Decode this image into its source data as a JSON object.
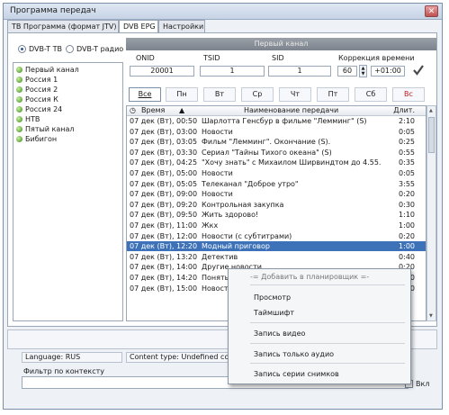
{
  "window": {
    "title": "Программа передач",
    "close_label": "✕"
  },
  "tabs": [
    {
      "label": "ТВ Программа (формат JTV)"
    },
    {
      "label": "DVB EPG"
    },
    {
      "label": "Настройки"
    }
  ],
  "source": {
    "dvbt_tv": "DVB-T ТВ",
    "dvbt_radio": "DVB-T радио",
    "selected": "DVB-T ТВ"
  },
  "channels": [
    {
      "name": "Первый канал"
    },
    {
      "name": "Россия 1"
    },
    {
      "name": "Россия 2"
    },
    {
      "name": "Россия К"
    },
    {
      "name": "Россия 24"
    },
    {
      "name": "НТВ"
    },
    {
      "name": "Пятый канал"
    },
    {
      "name": "Бибигон"
    }
  ],
  "channel_header": "Первый канал",
  "ids": {
    "onid_label": "ONID",
    "onid": "20001",
    "tsid_label": "TSID",
    "tsid": "1",
    "sid_label": "SID",
    "sid": "1",
    "correction_label": "Коррекция времени",
    "correction_minutes": "60",
    "correction_offset": "+01:00",
    "apply_icon": "checkmark-icon"
  },
  "days": [
    {
      "label": "Все"
    },
    {
      "label": "Пн"
    },
    {
      "label": "Вт"
    },
    {
      "label": "Ср"
    },
    {
      "label": "Чт"
    },
    {
      "label": "Пт"
    },
    {
      "label": "Сб"
    },
    {
      "label": "Вс"
    }
  ],
  "selected_day": "Все",
  "sunday_color": "#c02020",
  "grid": {
    "col_time": "Время",
    "col_name": "Наименование передачи",
    "col_duration": "Длит.",
    "rows": [
      {
        "time": "07 дек (Вт), 00:50",
        "name": "Шарлотта Генсбур в фильме \"Лемминг\" (S)",
        "dur": "2:10"
      },
      {
        "time": "07 дек (Вт), 03:00",
        "name": "Новости",
        "dur": "0:05"
      },
      {
        "time": "07 дек (Вт), 03:05",
        "name": "Фильм \"Лемминг\". Окончание (S).",
        "dur": "0:25"
      },
      {
        "time": "07 дек (Вт), 03:30",
        "name": "Сериал \"Тайны Тихого океана\" (S)",
        "dur": "0:55"
      },
      {
        "time": "07 дек (Вт), 04:25",
        "name": "\"Хочу знать\" с Михаилом Ширвиндтом до 4.55.",
        "dur": "0:35"
      },
      {
        "time": "07 дек (Вт), 05:00",
        "name": "Новости",
        "dur": "0:05"
      },
      {
        "time": "07 дек (Вт), 05:05",
        "name": "Телеканал \"Доброе утро\"",
        "dur": "3:55"
      },
      {
        "time": "07 дек (Вт), 09:00",
        "name": "Новости",
        "dur": "0:20"
      },
      {
        "time": "07 дек (Вт), 09:20",
        "name": "Контрольная закупка",
        "dur": "0:30"
      },
      {
        "time": "07 дек (Вт), 09:50",
        "name": "Жить здорово!",
        "dur": "1:10"
      },
      {
        "time": "07 дек (Вт), 11:00",
        "name": "Жкх",
        "dur": "1:00"
      },
      {
        "time": "07 дек (Вт), 12:00",
        "name": "Новости (с субтитрами)",
        "dur": "0:20"
      },
      {
        "time": "07 дек (Вт), 12:20",
        "name": "Модный приговор",
        "dur": "1:00"
      },
      {
        "time": "07 дек (Вт), 13:20",
        "name": "Детектив",
        "dur": "0:40"
      },
      {
        "time": "07 дек (Вт), 14:00",
        "name": "Другие новости",
        "dur": "0:20"
      },
      {
        "time": "07 дек (Вт), 14:20",
        "name": "Понять. Простить",
        "dur": "0:40"
      },
      {
        "time": "07 дек (Вт), 15:00",
        "name": "Новости",
        "dur": "0:20"
      }
    ],
    "selected_index": 12
  },
  "status": {
    "language": "Language: RUS",
    "content_type": "Content type: Undefined con"
  },
  "filter": {
    "label": "Фильтр по контексту",
    "value": "",
    "checkbox_label": "Вкл"
  },
  "context_menu": {
    "header": "-= Добавить в планировщик =-",
    "items": [
      {
        "label": "Просмотр"
      },
      {
        "label": "Таймшифт"
      },
      {
        "label": "Запись видео"
      },
      {
        "label": "Запись только аудио"
      },
      {
        "label": "Запись серии снимков"
      }
    ]
  }
}
